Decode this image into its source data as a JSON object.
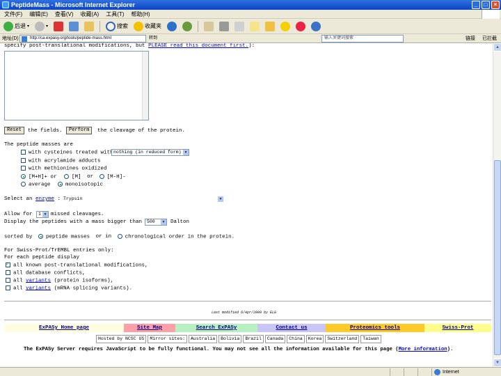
{
  "window": {
    "title": "PeptideMass - Microsoft Internet Explorer"
  },
  "menu": [
    "文件(F)",
    "编辑(E)",
    "查看(V)",
    "收藏(A)",
    "工具(T)",
    "帮助(H)"
  ],
  "toolbar": {
    "back": "后退",
    "search": "搜索",
    "favorites": "收藏夹"
  },
  "address": {
    "label": "地址(D)",
    "url": "http://ca.expasy.org/tools/peptide-mass.html",
    "go": "转到",
    "search_placeholder": "输入关键词搜索",
    "links_label": "链接",
    "ext": "已拦截"
  },
  "page": {
    "line_top": "specify post-translational modifications, but",
    "line_top_link": "PLEASE read this document first.",
    "line_top_end": "):",
    "reset_button": "Reset",
    "reset_text": "the fields.",
    "perform_button": "Perform",
    "perform_text": "the cleavage of the protein.",
    "peptides_masses_are": "The peptide masses are",
    "cys_label": "with cysteines treated with:",
    "cys_value": "nothing (in reduced form)",
    "acrylamide": "with acrylamide adducts",
    "methionines": "with methionines oxidized",
    "mh_label": "[M+H]+ or",
    "m_label": "[M]",
    "or": "or",
    "mh_neg_label": "[M-H]-",
    "monoisotopic": "monoisotopic",
    "average": "average",
    "select_enzyme": "Select an",
    "enzyme_link": "enzyme",
    "enzyme_value": "Trypsin",
    "allow_prefix": "Allow for",
    "missed_value": "1",
    "missed_suffix": "missed cleavages.",
    "display_prefix": "Display the peptides with a mass bigger than",
    "mass_value": "500",
    "mass_unit": "Dalton",
    "sorted_by": "sorted by",
    "peptide_masses": "peptide masses",
    "or_in": "or in",
    "chronological": "chronological order in the protein.",
    "swiss_header": "For Swiss-Prot/TrEMBL entries only:",
    "each_peptide": "For each peptide display",
    "opt1": "all known post-translational modifications,",
    "opt2": "all database conflicts,",
    "opt3_link": "variants",
    "opt3_pre": "all",
    "opt3_post": "(protein isoforms),",
    "opt4_pre": "all",
    "opt4_link": "variants",
    "opt4_post": "(mRNA splicing variants).",
    "last_modified": "Last modified 6/Apr/2009 by ELG"
  },
  "footer_nav": [
    {
      "label": "ExPASy Home page",
      "color": "#fffde0"
    },
    {
      "label": "Site Map",
      "color": "#ff9fa8"
    },
    {
      "label": "Search ExPASy",
      "color": "#b9f0c2"
    },
    {
      "label": "Contact us",
      "color": "#c9c6f7"
    },
    {
      "label": "Proteomics tools",
      "color": "#ffc928"
    },
    {
      "label": "Swiss-Prot",
      "color": "#fffd8a"
    }
  ],
  "mirrors": [
    "Hosted by NCSC US",
    "Mirror sites:",
    "Australia",
    "Bolivia",
    "Brazil",
    "Canada",
    "China",
    "Korea",
    "Switzerland",
    "Taiwan"
  ],
  "js_notice": "The ExPASy Server requires JavaScript to be fully functional. You may not see all the information available for this page (",
  "js_more": "More information",
  "js_end": ").",
  "status": {
    "text": "",
    "zone": "Internet"
  }
}
